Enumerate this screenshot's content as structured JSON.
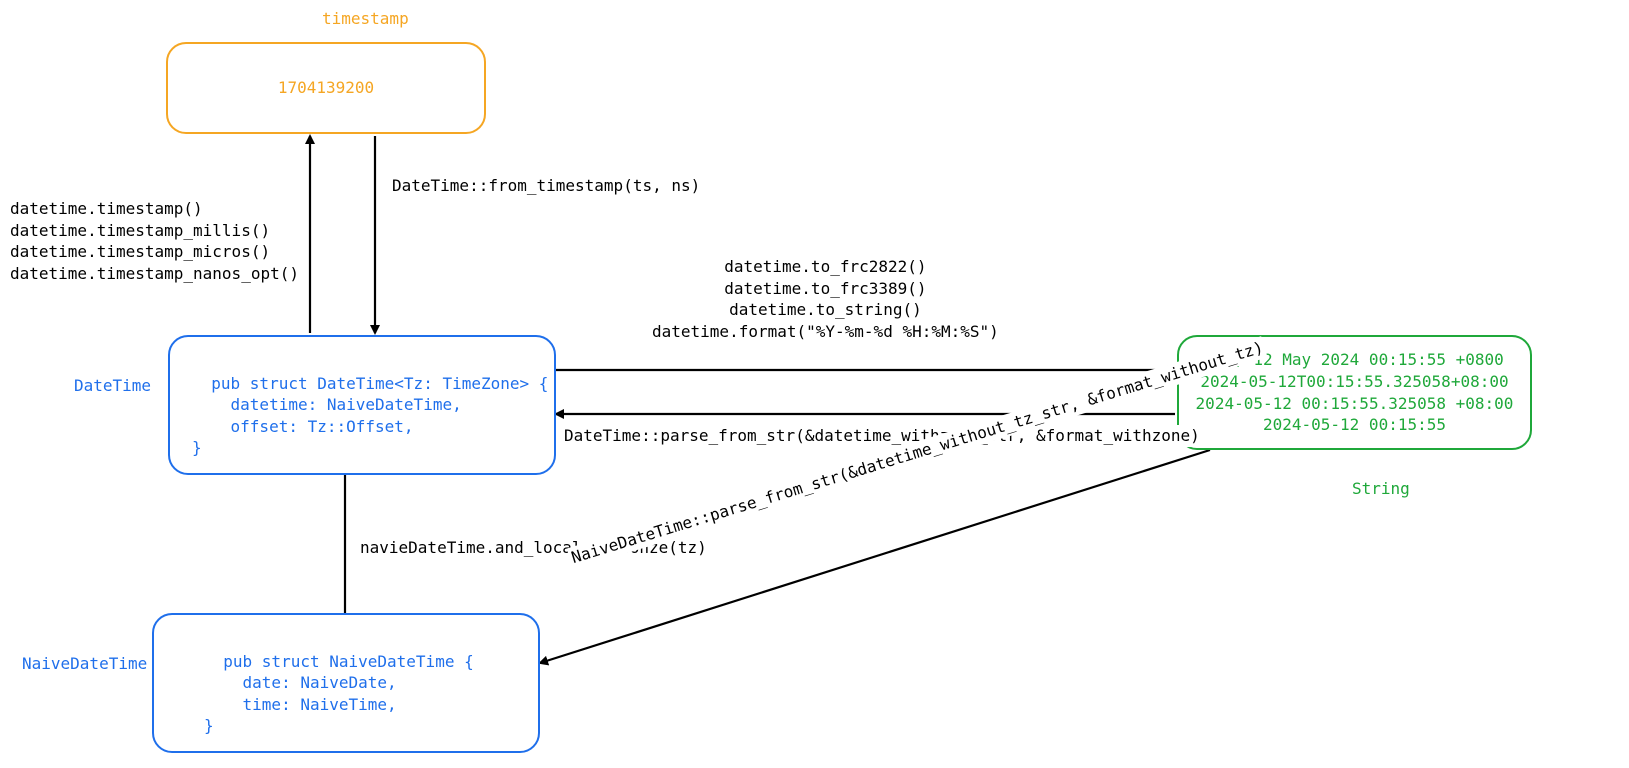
{
  "nodes": {
    "timestamp": {
      "title": "timestamp",
      "content": "1704139200"
    },
    "datetime": {
      "title": "DateTime",
      "content": "pub struct DateTime<Tz: TimeZone> {\n    datetime: NaiveDateTime,\n    offset: Tz::Offset,\n}"
    },
    "naivedatetime": {
      "title": "NaiveDateTime",
      "content": "pub struct NaiveDateTime {\n    date: NaiveDate,\n    time: NaiveTime,\n}"
    },
    "string": {
      "title": "String",
      "content": "Sun, 12 May 2024 00:15:55 +0800\n2024-05-12T00:15:55.325058+08:00\n2024-05-12 00:15:55.325058 +08:00\n2024-05-12 00:15:55"
    }
  },
  "edges": {
    "dt_to_ts": "datetime.timestamp()\ndatetime.timestamp_millis()\ndatetime.timestamp_micros()\ndatetime.timestamp_nanos_opt()",
    "ts_to_dt": "DateTime::from_timestamp(ts, ns)",
    "dt_to_str": "datetime.to_frc2822()\ndatetime.to_frc3389()\ndatetime.to_string()\ndatetime.format(\"%Y-%m-%d %H:%M:%S\")",
    "str_to_dt": "DateTime::parse_from_str(&datetime_withzone_str, &format_withzone)",
    "ndt_to_dt": "navieDateTime.and_local_timeonze(tz)",
    "str_to_ndt": "NaiveDateTime::parse_from_str(&datetime_without_tz_str, &format_without_tz)"
  }
}
